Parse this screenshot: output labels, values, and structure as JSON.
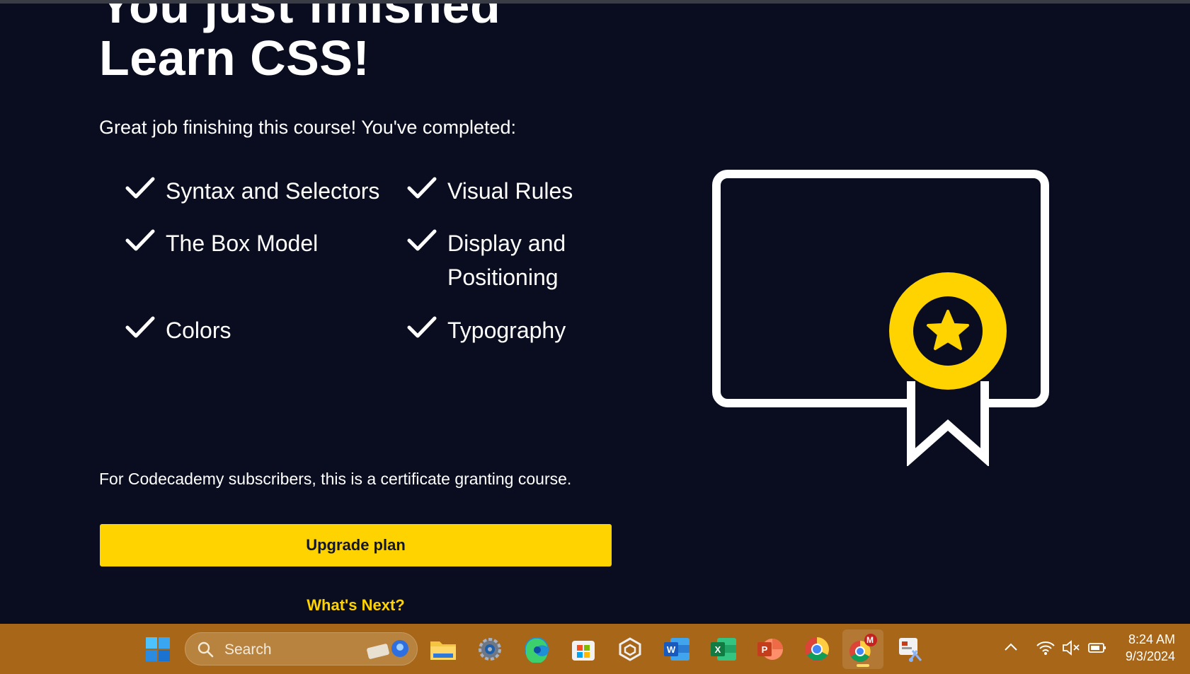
{
  "page": {
    "title_line1": "You just finished",
    "title_line2": "Learn CSS!",
    "subtitle": "Great job finishing this course! You've completed:",
    "completed_items": [
      "Syntax and Selectors",
      "Visual Rules",
      "The Box Model",
      "Display and Positioning",
      "Colors",
      "Typography"
    ],
    "notice": "For Codecademy subscribers, this is a certificate granting course.",
    "upgrade_label": "Upgrade plan",
    "whats_next_label": "What's Next?",
    "icons": {
      "check": "check-icon",
      "certificate": "certificate-icon"
    }
  },
  "colors": {
    "background": "#0a0d1f",
    "accent": "#ffd300",
    "text": "#ffffff",
    "taskbar": "#a86619"
  },
  "taskbar": {
    "search_placeholder": "Search",
    "apps": [
      "windows-start",
      "file-explorer",
      "settings",
      "edge",
      "microsoft-store",
      "app-cube",
      "word",
      "excel",
      "powerpoint",
      "chrome",
      "chrome-profile",
      "snipping-tool"
    ],
    "chrome_profile_badge": "M",
    "time": "8:24 AM",
    "date": "9/3/2024"
  }
}
